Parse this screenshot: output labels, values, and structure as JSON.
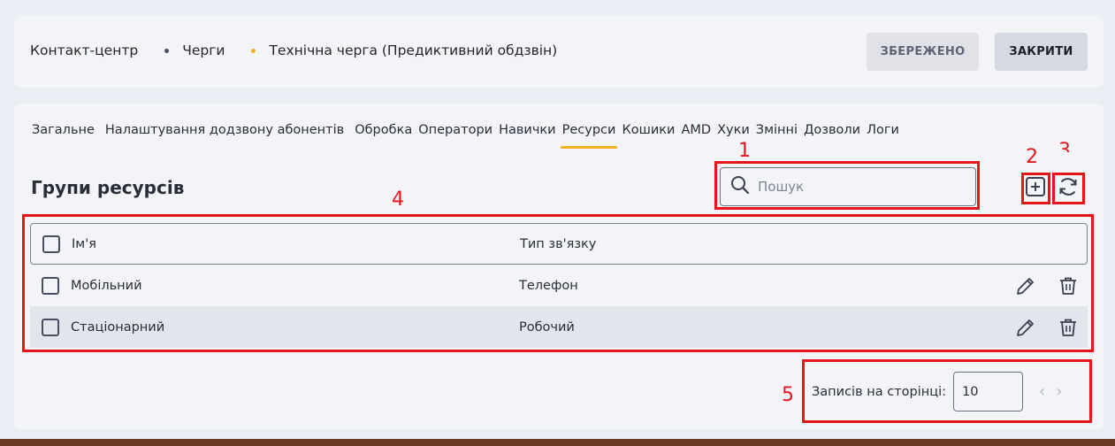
{
  "breadcrumb": {
    "items": [
      "Контакт-центр",
      "Черги",
      "Технічна черга (Предиктивний обдзвін)"
    ]
  },
  "header": {
    "saved_label": "ЗБЕРЕЖЕНО",
    "close_label": "ЗАКРИТИ"
  },
  "tabs": [
    "Загальне",
    "Налаштування додзвону абонентів",
    "Обробка",
    "Оператори",
    "Навички",
    "Ресурси",
    "Кошики",
    "AMD",
    "Хуки",
    "Змінні",
    "Дозволи",
    "Логи"
  ],
  "active_tab": "Ресурси",
  "section": {
    "title": "Групи ресурсів"
  },
  "search": {
    "placeholder": "Пошук",
    "icon": "search-icon"
  },
  "toolbar": {
    "add_icon": "plus-square-icon",
    "refresh_icon": "refresh-icon"
  },
  "table": {
    "columns": [
      "Ім'я",
      "Тип зв'язку"
    ],
    "rows": [
      {
        "name": "Мобільний",
        "type": "Телефон"
      },
      {
        "name": "Стаціонарний",
        "type": "Робочий"
      }
    ]
  },
  "pager": {
    "label": "Записів на сторінці:",
    "value": "10",
    "prev_icon": "chevron-left-icon",
    "next_icon": "chevron-right-icon"
  },
  "annotations": [
    "1",
    "2",
    "3",
    "4",
    "5"
  ],
  "colors": {
    "accent": "#f1b11f",
    "annotation": "#e8141c",
    "background": "#eaedf3",
    "card": "#f3f4f8"
  }
}
